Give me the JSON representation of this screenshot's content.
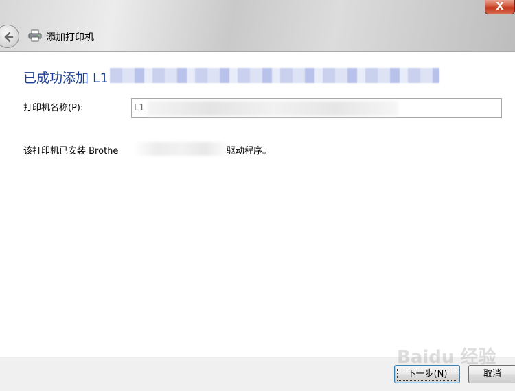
{
  "window": {
    "title": "添加打印机",
    "close_label": "X"
  },
  "icons": {
    "back": "back-arrow-icon",
    "printer": "printer-icon"
  },
  "main": {
    "heading": "已成功添加 L1",
    "printer_name_label": "打印机名称(P):",
    "printer_name_value": "L1",
    "driver_prefix": "该打印机已安装 Brothe",
    "driver_suffix": "驱动程序。"
  },
  "footer": {
    "next_label": "下一步(N)",
    "cancel_label": "取消"
  },
  "watermark": {
    "text": "Baidu 经验"
  },
  "colors": {
    "heading": "#1c3f94",
    "close": "#c2371c"
  }
}
